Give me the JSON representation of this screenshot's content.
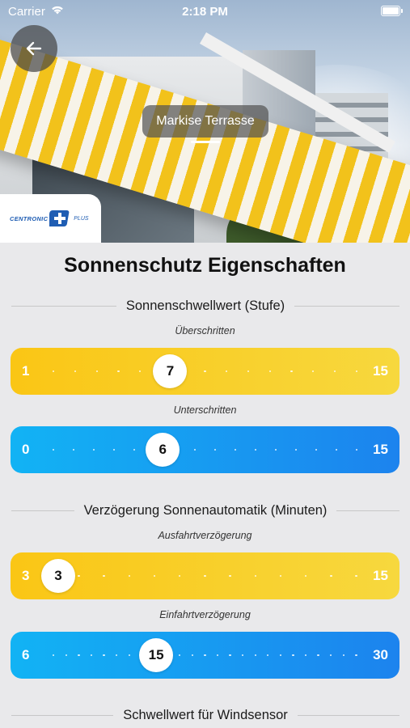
{
  "status_bar": {
    "carrier": "Carrier",
    "time": "2:18 PM"
  },
  "hero": {
    "back_icon": "arrow-left-icon",
    "device_name": "Markise Terrasse",
    "logo": {
      "brand": "CENTRONIC",
      "suffix": "PLUS"
    }
  },
  "page": {
    "title": "Sonnenschutz Eigenschaften"
  },
  "sections": {
    "sun_threshold": "Sonnenschwellwert (Stufe)",
    "sun_delay": "Verzögerung Sonnenautomatik (Minuten)",
    "wind_threshold": "Schwellwert für Windsensor"
  },
  "sliders": {
    "exceeded": {
      "label": "Überschritten",
      "min": "1",
      "max": "15",
      "value": "7",
      "color": "yellow"
    },
    "undershot": {
      "label": "Unterschritten",
      "min": "0",
      "max": "15",
      "value": "6",
      "color": "blue"
    },
    "extend_delay": {
      "label": "Ausfahrtverzögerung",
      "min": "3",
      "max": "15",
      "value": "3",
      "color": "yellow"
    },
    "retract_delay": {
      "label": "Einfahrtverzögerung",
      "min": "6",
      "max": "30",
      "value": "15",
      "color": "blue"
    }
  },
  "colors": {
    "yellow_start": "#fac615",
    "yellow_end": "#f7d83e",
    "blue_start": "#12b3f4",
    "blue_end": "#1c83ee",
    "background": "#e9e9eb"
  }
}
